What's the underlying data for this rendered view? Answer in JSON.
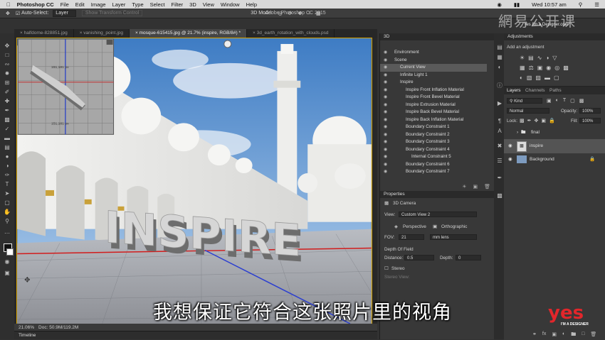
{
  "menubar": {
    "app": "Photoshop CC",
    "items": [
      "File",
      "Edit",
      "Image",
      "Layer",
      "Type",
      "Select",
      "Filter",
      "3D",
      "View",
      "Window",
      "Help"
    ],
    "clock": "Wed 10:57 am"
  },
  "window_title": "Adobe Photoshop CC 2015",
  "options": {
    "auto_select": "Auto-Select:",
    "auto_select_value": "Layer",
    "show_transform": "Show Transform Control",
    "mode_3d": "3D Mode:"
  },
  "tabs": [
    "halfdome-828851.jpg",
    "vanishing_point.jpg",
    "mosque-615415.jpg @ 21.7% (inspire, RGB/8#) *",
    "3d_earth_rotation_with_clouds.psd"
  ],
  "canvas": {
    "ruler_top": "151,181 px",
    "ruler_bottom": "151,181 px",
    "word": "INSPIRE"
  },
  "status": {
    "zoom": "21.06%",
    "doc": "Doc: 50.9M/119.2M"
  },
  "timeline": "Timeline",
  "panel3d": {
    "title": "3D",
    "rows": [
      {
        "label": "Environment",
        "indent": 0
      },
      {
        "label": "Scene",
        "indent": 0
      },
      {
        "label": "Current View",
        "indent": 1,
        "selected": true
      },
      {
        "label": "Infinite Light 1",
        "indent": 1
      },
      {
        "label": "Inspire",
        "indent": 1
      },
      {
        "label": "Inspire Front Inflation Material",
        "indent": 2
      },
      {
        "label": "Inspire Front Bevel Material",
        "indent": 2
      },
      {
        "label": "Inspire Extrusion Material",
        "indent": 2
      },
      {
        "label": "Inspire Back Bevel Material",
        "indent": 2
      },
      {
        "label": "Inspire Back Inflation Material",
        "indent": 2
      },
      {
        "label": "Boundary Constraint 1",
        "indent": 2
      },
      {
        "label": "Boundary Constraint 2",
        "indent": 2
      },
      {
        "label": "Boundary Constraint 3",
        "indent": 2
      },
      {
        "label": "Boundary Constraint 4",
        "indent": 2
      },
      {
        "label": "Internal Constraint 5",
        "indent": 3
      },
      {
        "label": "Boundary Constraint 6",
        "indent": 2
      },
      {
        "label": "Boundary Constraint 7",
        "indent": 2
      }
    ]
  },
  "properties": {
    "title": "Properties",
    "camera": "3D Camera",
    "view_label": "View:",
    "view_value": "Custom View 2",
    "perspective": "Perspective",
    "orthographic": "Orthographic",
    "fov_label": "FOV:",
    "fov_value": "21",
    "lens": "mm lens",
    "dof": "Depth Of Field",
    "distance_label": "Distance:",
    "distance_value": "0.5",
    "depth_label": "Depth:",
    "depth_value": "0",
    "stereo": "Stereo",
    "stereo_view": "Stereo View:"
  },
  "adjustments": {
    "title": "Adjustments",
    "hint": "Add an adjustment"
  },
  "layers": {
    "tabs": [
      "Layers",
      "Channels",
      "Paths"
    ],
    "kind": "Kind",
    "blend": "Normal",
    "opacity_label": "Opacity:",
    "opacity": "100%",
    "lock": "Lock:",
    "fill_label": "Fill:",
    "fill": "100%",
    "items": [
      {
        "name": "final",
        "type": "folder"
      },
      {
        "name": "inspire",
        "type": "3d",
        "selected": true
      },
      {
        "name": "Background",
        "type": "image"
      }
    ]
  },
  "subtitle": "我想保证它符合这张照片里的视角",
  "brand": {
    "logo": "yes",
    "tagline": "I'M A DESIGNER",
    "watermark": "網易公开课",
    "watermark_sub": "Yes I'm a Designer.com"
  }
}
